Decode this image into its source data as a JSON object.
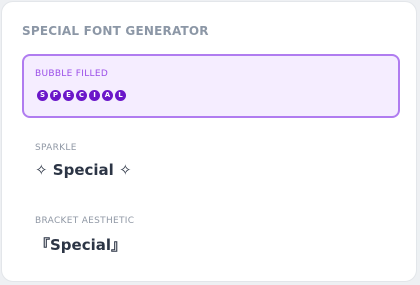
{
  "heading": "SPECIAL FONT GENERATOR",
  "options": [
    {
      "label": "BUBBLE FILLED",
      "letters": [
        "S",
        "P",
        "E",
        "C",
        "I",
        "A",
        "L"
      ],
      "selected": true
    },
    {
      "label": "SPARKLE",
      "text": "✧ Special ✧",
      "selected": false
    },
    {
      "label": "BRACKET AESTHETIC",
      "text": "『Special』",
      "selected": false
    }
  ],
  "colors": {
    "accent": "#b07cf0",
    "accent_dark": "#6b17c9",
    "selected_bg": "#f5edff"
  }
}
